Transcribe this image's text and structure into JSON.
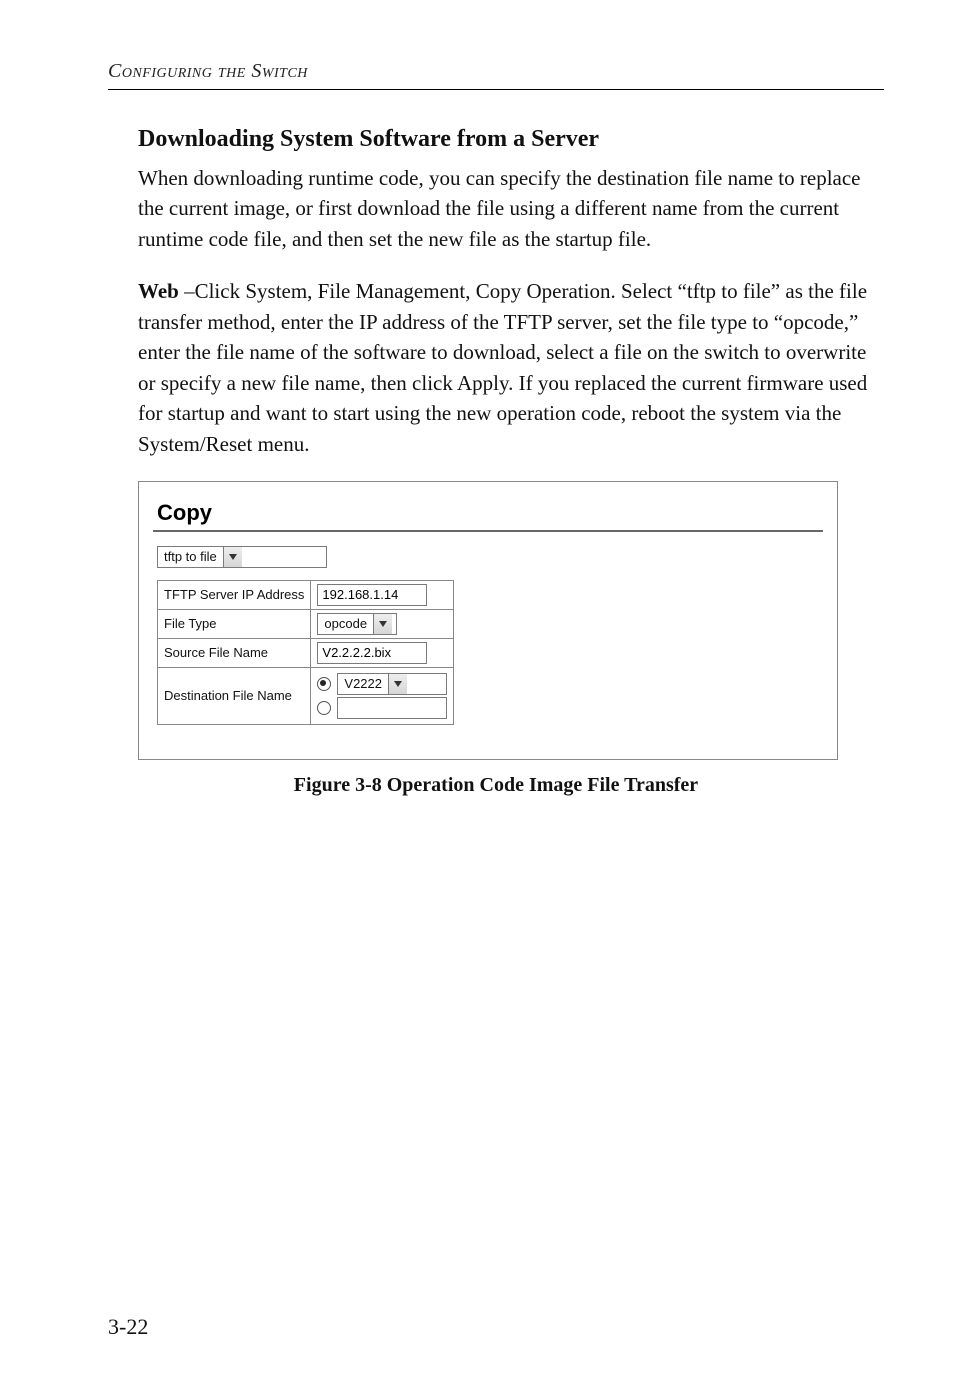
{
  "header": {
    "running_title": "Configuring the Switch"
  },
  "section": {
    "heading": "Downloading System Software from a Server",
    "p1": "When downloading runtime code, you can specify the destination file name to replace the current image, or first download the file using a different name from the current runtime code file, and then set the new file as the startup file.",
    "p2_lead": "Web",
    "p2_rest": " –Click System, File Management, Copy Operation. Select “tftp to file” as the file transfer method, enter the IP address of the TFTP server, set the file type to “opcode,” enter the file name of the software to download, select a file on the switch to overwrite or specify a new file name, then click Apply. If you replaced the current firmware used for startup and want to start using the new operation code, reboot the system via the System/Reset menu."
  },
  "screenshot": {
    "title": "Copy",
    "method_selected": "tftp to file",
    "rows": {
      "tftp_label": "TFTP Server IP Address",
      "tftp_value": "192.168.1.14",
      "filetype_label": "File Type",
      "filetype_value": "opcode",
      "srcname_label": "Source File Name",
      "srcname_value": "V2.2.2.2.bix",
      "destname_label": "Destination File Name",
      "dest_select_value": "V2222",
      "dest_text_value": ""
    }
  },
  "figure_caption": "Figure 3-8  Operation Code Image File Transfer",
  "page_number": "3-22"
}
